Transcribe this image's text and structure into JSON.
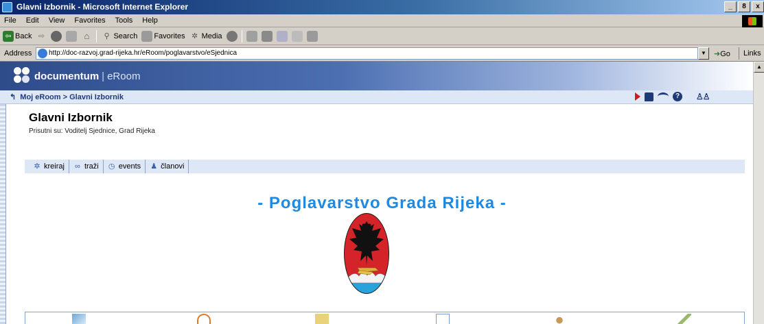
{
  "window": {
    "title": "Glavni Izbornik - Microsoft Internet Explorer",
    "minimize": "_",
    "maximize": "8",
    "close": "x"
  },
  "menu": [
    "File",
    "Edit",
    "View",
    "Favorites",
    "Tools",
    "Help"
  ],
  "toolbar": {
    "back": "Back",
    "search": "Search",
    "favorites": "Favorites",
    "media": "Media"
  },
  "address": {
    "label": "Address",
    "url": "http://doc-razvoj.grad-rijeka.hr/eRoom/poglavarstvo/eSjednica",
    "go": "Go",
    "links": "Links"
  },
  "banner": {
    "brand": "documentum",
    "product": "eRoom"
  },
  "breadcrumb": {
    "home": "Moj eRoom",
    "separator": ">",
    "current": "Glavni Izbornik"
  },
  "page": {
    "title": "Glavni Izbornik",
    "present": "Prisutni su: Voditelj Sjednice, Grad Rijeka",
    "heading": "- Poglavarstvo Grada Rijeka -"
  },
  "actions": [
    {
      "label": "kreiraj",
      "icon": "create-icon"
    },
    {
      "label": "traži",
      "icon": "binoculars-icon"
    },
    {
      "label": "events",
      "icon": "clock-icon"
    },
    {
      "label": "članovi",
      "icon": "members-icon"
    }
  ],
  "colors": {
    "heading": "#1f8ae0",
    "banner": "#2e4b8a",
    "navbar": "#dde7f5",
    "titlebar": "#0a246a"
  }
}
